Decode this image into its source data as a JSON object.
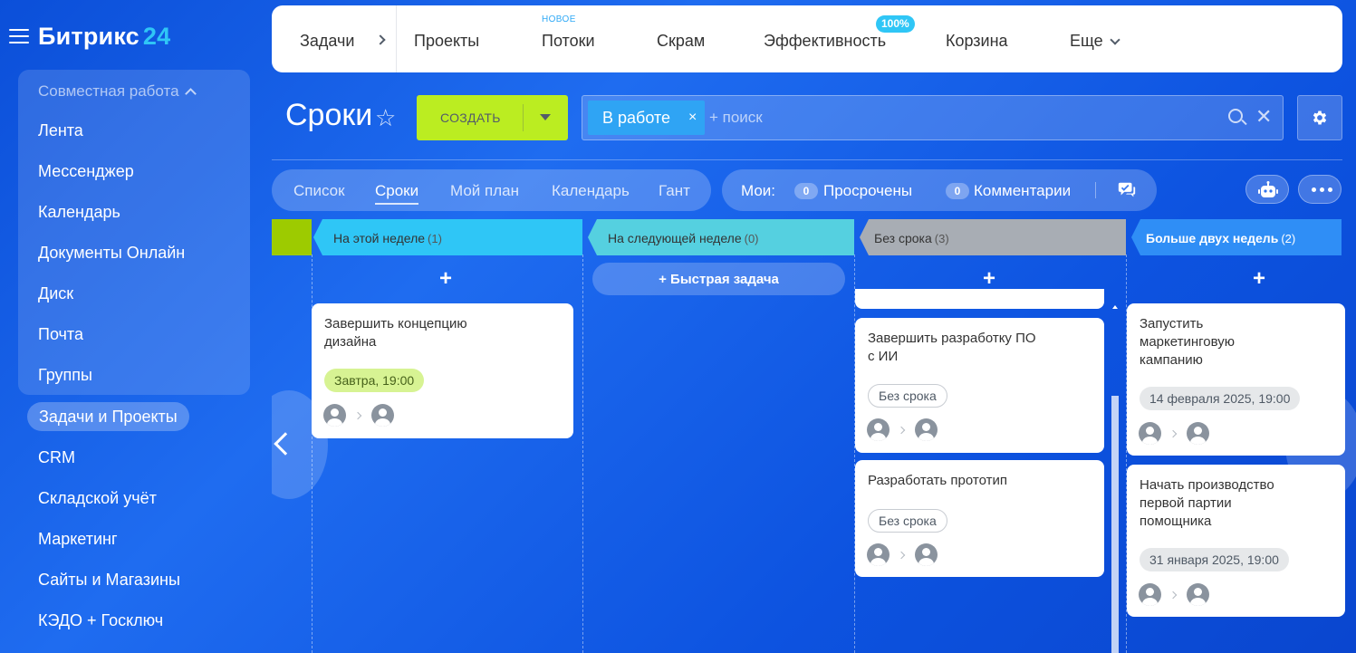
{
  "logo": {
    "name": "Битрикс",
    "number": "24"
  },
  "sidebar": {
    "group_title": "Совместная работа",
    "group_items": [
      {
        "label": "Лента"
      },
      {
        "label": "Мессенджер"
      },
      {
        "label": "Календарь"
      },
      {
        "label": "Документы Онлайн"
      },
      {
        "label": "Диск"
      },
      {
        "label": "Почта"
      },
      {
        "label": "Группы"
      }
    ],
    "active_item": "Задачи и Проекты",
    "items": [
      {
        "label": "CRM"
      },
      {
        "label": "Складской учёт"
      },
      {
        "label": "Маркетинг"
      },
      {
        "label": "Сайты и Магазины"
      },
      {
        "label": "КЭДО + Госключ"
      }
    ]
  },
  "topnav": {
    "tabs": [
      {
        "label": "Задачи"
      },
      {
        "label": "Проекты"
      },
      {
        "label": "Потоки"
      },
      {
        "label": "Скрам"
      },
      {
        "label": "Эффективность"
      },
      {
        "label": "Корзина"
      },
      {
        "label": "Еще"
      }
    ],
    "new_badge": "НОВОЕ",
    "efficiency_badge": "100%"
  },
  "page": {
    "title": "Сроки"
  },
  "create_button": {
    "label": "СОЗДАТЬ"
  },
  "search": {
    "filter_chip": "В работе",
    "filter_remove": "×",
    "placeholder": "+ поиск",
    "clear": "✕"
  },
  "views": {
    "tabs": [
      {
        "label": "Список"
      },
      {
        "label": "Сроки"
      },
      {
        "label": "Мой план"
      },
      {
        "label": "Календарь"
      },
      {
        "label": "Гант"
      }
    ],
    "selected": "Сроки"
  },
  "counters": {
    "label": "Мои:",
    "items": [
      {
        "count": "0",
        "label": "Просрочены"
      },
      {
        "count": "0",
        "label": "Комментарии"
      }
    ]
  },
  "icons": {
    "burger": "menu-icon",
    "star": "star-icon",
    "gear": "gear-icon",
    "search": "search-icon",
    "chat": "chat-icon",
    "robot": "robot-icon",
    "more": "more-icon",
    "avatar": "user-avatar-icon"
  },
  "colors": {
    "accent_green": "#bbed21",
    "col_this_week": "#2fc6f6",
    "col_next_week": "#55d0e0",
    "col_no_deadline": "#a8adb4",
    "col_more_two_weeks": "#2f8ef6"
  },
  "kanban": {
    "quick_task": "+ Быстрая задача",
    "plus": "+",
    "columns": [
      {
        "title": "На этой неделе",
        "count": "(1)"
      },
      {
        "title": "На следующей неделе",
        "count": "(0)"
      },
      {
        "title": "Без срока",
        "count": "(3)"
      },
      {
        "title": "Больше двух недель",
        "count": "(2)"
      }
    ],
    "cards": {
      "this_week": [
        {
          "title": "Завершить концепцию дизайна",
          "deadline": "Завтра, 19:00"
        }
      ],
      "no_deadline": [
        {
          "title": "Завершить разработку ПО с ИИ",
          "deadline": "Без срока"
        },
        {
          "title": "Разработать прототип",
          "deadline": "Без срока"
        }
      ],
      "more_two_weeks": [
        {
          "title": "Запустить маркетинговую кампанию",
          "deadline": "14 февраля 2025, 19:00"
        },
        {
          "title": "Начать производство первой партии помощника",
          "deadline": "31 января 2025, 19:00"
        }
      ]
    }
  }
}
